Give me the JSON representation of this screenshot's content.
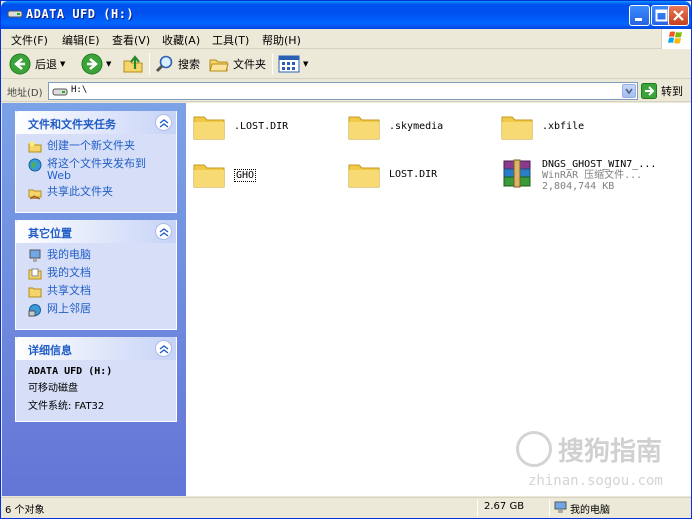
{
  "window": {
    "title": "ADATA UFD (H:)"
  },
  "menu": [
    "文件(F)",
    "编辑(E)",
    "查看(V)",
    "收藏(A)",
    "工具(T)",
    "帮助(H)"
  ],
  "toolbar": {
    "back_label": "后退",
    "search_label": "搜索",
    "folders_label": "文件夹"
  },
  "address": {
    "label": "地址(D)",
    "value": "H:\\",
    "go_label": "转到"
  },
  "tasks": {
    "title": "文件和文件夹任务",
    "items": [
      "创建一个新文件夹",
      "将这个文件夹发布到 Web",
      "共享此文件夹"
    ]
  },
  "other_places": {
    "title": "其它位置",
    "items": [
      "我的电脑",
      "我的文档",
      "共享文档",
      "网上邻居"
    ]
  },
  "details": {
    "title": "详细信息",
    "drive_name": "ADATA UFD (H:)",
    "drive_type": "可移动磁盘",
    "fs": "文件系统: FAT32"
  },
  "files": [
    {
      "name": ".LOST.DIR",
      "type": "folder"
    },
    {
      "name": ".skymedia",
      "type": "folder"
    },
    {
      "name": ".xbfile",
      "type": "folder"
    },
    {
      "name": "GHO",
      "type": "folder"
    },
    {
      "name": "LOST.DIR",
      "type": "folder"
    },
    {
      "name": "DNGS_GHOST_WIN7_...",
      "type": "rar",
      "line2": "WinRAR 压缩文件...",
      "line3": "2,804,744 KB"
    }
  ],
  "status": {
    "count": "6 个对象",
    "size": "2.67 GB",
    "location": "我的电脑"
  },
  "watermark": {
    "text": "搜狗指南",
    "url": "zhinan.sogou.com"
  },
  "colors": {
    "title_bar": "#0053ee",
    "left_pane": "#7ba2e7",
    "link": "#215dc6",
    "folder": "#f5d56b"
  }
}
